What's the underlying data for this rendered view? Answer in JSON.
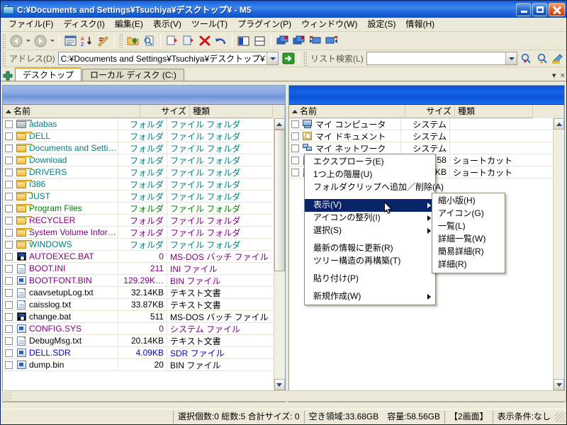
{
  "window": {
    "title": "C:¥Documents and Settings¥Tsuchiya¥デスクトップ¥ - M5",
    "icon": "folder-window-icon",
    "minimize_label": "",
    "maximize_label": "",
    "close_label": ""
  },
  "menubar": {
    "items": [
      {
        "label": "ファイル(F)"
      },
      {
        "label": "ディスク(I)"
      },
      {
        "label": "編集(E)"
      },
      {
        "label": "表示(V)"
      },
      {
        "label": "ツール(T)"
      },
      {
        "label": "プラグイン(P)"
      },
      {
        "label": "ウィンドウ(W)"
      },
      {
        "label": "設定(S)"
      },
      {
        "label": "情報(H)"
      }
    ]
  },
  "toolbar": {
    "buttons": [
      {
        "name": "back-icon"
      },
      {
        "name": "back-dropdown-icon"
      },
      {
        "name": "forward-icon"
      },
      {
        "name": "forward-dropdown-icon"
      },
      {
        "name": "list-view-icon"
      },
      {
        "name": "sort-az-icon"
      },
      {
        "name": "sort-custom-icon"
      },
      {
        "name": "open-folder-icon"
      },
      {
        "name": "search-file-icon"
      },
      {
        "name": "copy-icon"
      },
      {
        "name": "move-icon"
      },
      {
        "name": "delete-icon"
      },
      {
        "name": "undo-icon"
      },
      {
        "name": "single-pane-icon"
      },
      {
        "name": "split-pane-icon"
      },
      {
        "name": "tab-duplicate-icon"
      },
      {
        "name": "tab-new-icon"
      },
      {
        "name": "tab-close-left-icon"
      },
      {
        "name": "tab-close-right-icon"
      }
    ]
  },
  "addressbar": {
    "label": "アドレス(D)",
    "value": "C:¥Documents and Settings¥Tsuchiya¥デスクトップ¥",
    "placeholder": "",
    "go_label": "",
    "search_label": "リスト検索(L)",
    "search_value": "",
    "search_placeholder": ""
  },
  "tabs": {
    "items": [
      {
        "label": "デスクトップ",
        "active": true
      },
      {
        "label": "ローカル ディスク (C:)",
        "active": false
      }
    ],
    "add_label": "+",
    "right_controls": [
      "▾",
      "×"
    ]
  },
  "columns": {
    "name": "名前",
    "size": "サイズ",
    "type": "種類"
  },
  "left_pane": {
    "active": false,
    "rows": [
      {
        "icon": "folder-grey-icon",
        "name": "adabas",
        "size": "フォルダ",
        "type": "ファイル フォルダ",
        "color": "#008080"
      },
      {
        "icon": "folder-icon",
        "name": "DELL",
        "size": "フォルダ",
        "type": "ファイル フォルダ",
        "color": "#008080"
      },
      {
        "icon": "folder-icon",
        "name": "Documents and Setti…",
        "size": "フォルダ",
        "type": "ファイル フォルダ",
        "color": "#008080"
      },
      {
        "icon": "folder-icon",
        "name": "Download",
        "size": "フォルダ",
        "type": "ファイル フォルダ",
        "color": "#008080"
      },
      {
        "icon": "folder-icon",
        "name": "DRIVERS",
        "size": "フォルダ",
        "type": "ファイル フォルダ",
        "color": "#008080"
      },
      {
        "icon": "folder-icon",
        "name": "I386",
        "size": "フォルダ",
        "type": "ファイル フォルダ",
        "color": "#008080"
      },
      {
        "icon": "folder-icon",
        "name": "JUST",
        "size": "フォルダ",
        "type": "ファイル フォルダ",
        "color": "#008080"
      },
      {
        "icon": "folder-icon",
        "name": "Program Files",
        "size": "フォルダ",
        "type": "ファイル フォルダ",
        "color": "#008000"
      },
      {
        "icon": "folder-icon",
        "name": "RECYCLER",
        "size": "フォルダ",
        "type": "ファイル フォルダ",
        "color": "#800080"
      },
      {
        "icon": "folder-icon",
        "name": "System Volume Infor…",
        "size": "フォルダ",
        "type": "ファイル フォルダ",
        "color": "#800080"
      },
      {
        "icon": "folder-icon",
        "name": "WINDOWS",
        "size": "フォルダ",
        "type": "ファイル フォルダ",
        "color": "#008080"
      },
      {
        "icon": "bat-icon",
        "name": "AUTOEXEC.BAT",
        "size": "0",
        "type": "MS-DOS バッチ ファイル",
        "color": "#800080"
      },
      {
        "icon": "file-icon",
        "name": "BOOT.INI",
        "size": "211",
        "type": "INI ファイル",
        "color": "#800080"
      },
      {
        "icon": "sys-icon",
        "name": "BOOTFONT.BIN",
        "size": "129.29K…",
        "type": "BIN ファイル",
        "color": "#800080"
      },
      {
        "icon": "file-icon",
        "name": "caavsetupLog.txt",
        "size": "32.14KB",
        "type": "テキスト文書",
        "color": "#000000"
      },
      {
        "icon": "file-icon",
        "name": "caisslog.txt",
        "size": "33.87KB",
        "type": "テキスト文書",
        "color": "#000000"
      },
      {
        "icon": "bat-icon",
        "name": "change.bat",
        "size": "511",
        "type": "MS-DOS バッチ ファイル",
        "color": "#000000"
      },
      {
        "icon": "sys-icon",
        "name": "CONFIG.SYS",
        "size": "0",
        "type": "システム ファイル",
        "color": "#800080"
      },
      {
        "icon": "file-icon",
        "name": "DebugMsg.txt",
        "size": "20.14KB",
        "type": "テキスト文書",
        "color": "#000000"
      },
      {
        "icon": "sys-icon",
        "name": "DELL.SDR",
        "size": "4.09KB",
        "type": "SDR ファイル",
        "color": "#0000cd"
      },
      {
        "icon": "sys-icon",
        "name": "dump.bin",
        "size": "20",
        "type": "BIN ファイル",
        "color": "#000000"
      }
    ]
  },
  "right_pane": {
    "active": true,
    "rows": [
      {
        "icon": "my-computer-icon",
        "name": "マイ コンピュータ",
        "size": "システム",
        "type": "",
        "color": "#000000"
      },
      {
        "icon": "my-documents-icon",
        "name": "マイ ドキュメント",
        "size": "システム",
        "type": "",
        "color": "#000000"
      },
      {
        "icon": "network-icon",
        "name": "マイ ネットワーク",
        "size": "システム",
        "type": "",
        "color": "#000000"
      },
      {
        "icon": "shortcut-icon",
        "name": "",
        "size": "58",
        "type": "ショートカット",
        "color": "#000000"
      },
      {
        "icon": "shortcut-icon",
        "name": "",
        "size": "KB",
        "type": "ショートカット",
        "color": "#000000"
      }
    ]
  },
  "context_menu": {
    "items": [
      {
        "label": "エクスプローラ(E)",
        "submenu": false,
        "highlighted": false
      },
      {
        "label": "1つ上の階層(U)",
        "submenu": false,
        "highlighted": false
      },
      {
        "label": "フォルダクリップへ追加／削除(A)",
        "submenu": false,
        "highlighted": false
      },
      {
        "separator": true
      },
      {
        "label": "表示(V)",
        "submenu": true,
        "highlighted": true
      },
      {
        "label": "アイコンの整列(I)",
        "submenu": true,
        "highlighted": false
      },
      {
        "label": "選択(S)",
        "submenu": true,
        "highlighted": false
      },
      {
        "separator": true
      },
      {
        "label": "最新の情報に更新(R)",
        "submenu": false,
        "highlighted": false
      },
      {
        "label": "ツリー構造の再構築(T)",
        "submenu": false,
        "highlighted": false
      },
      {
        "separator": true
      },
      {
        "label": "貼り付け(P)",
        "submenu": false,
        "highlighted": false
      },
      {
        "separator": true
      },
      {
        "label": "新規作成(W)",
        "submenu": true,
        "highlighted": false
      }
    ]
  },
  "view_submenu": {
    "items": [
      {
        "label": "縮小版(H)"
      },
      {
        "label": "アイコン(G)"
      },
      {
        "label": "一覧(L)"
      },
      {
        "label": "詳細一覧(W)"
      },
      {
        "label": "簡易詳細(R)"
      },
      {
        "label": "詳細(R)"
      }
    ]
  },
  "statusbar": {
    "selection": "選択個数:0  総数:5  合計サイズ:    0",
    "free_space": "空き領域:33.68GB",
    "capacity": "容量:58.56GB",
    "pane_mode": "【2画面】",
    "filter": "表示条件:なし"
  },
  "colors": {
    "titlebar_active": "#0a58d8",
    "pane_active_header": "#0b50d0",
    "pane_inactive_header": "#9db8e8",
    "menu_highlight": "#0a246a",
    "face": "#ece9d8"
  }
}
